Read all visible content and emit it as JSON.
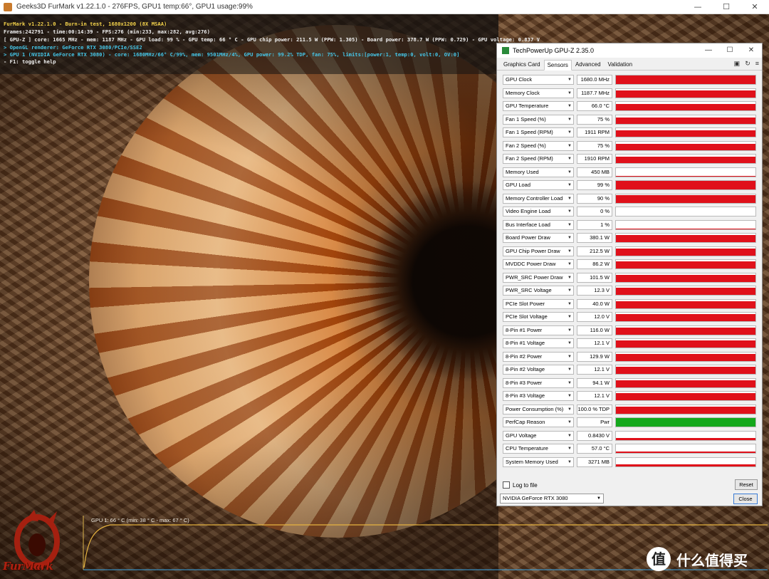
{
  "furmark": {
    "window_title": "Geeks3D FurMark v1.22.1.0 - 276FPS, GPU1 temp:66°, GPU1 usage:99%",
    "window_buttons": {
      "minimize": "—",
      "maximize": "☐",
      "close": "✕"
    },
    "overlay": [
      "FurMark v1.22.1.0 - Burn-in test, 1680x1200 (8X MSAA)",
      "Frames:242791 - time:00:14:39 - FPS:276 (min:233, max:282, avg:276)",
      "[ GPU-Z ] core: 1665 MHz - mem: 1187 MHz - GPU load: 99 % - GPU temp: 66 ° C - GPU chip power: 211.5 W (PPW: 1.305) - Board power: 378.7 W (PPW: 0.729) - GPU voltage: 0.837 V",
      "> OpenGL renderer: GeForce RTX 3080/PCIe/SSE2",
      "> GPU 1 (NVIDIA GeForce RTX 3080) - core: 1680MHz/66° C/99%, mem: 9501MHz/4%, GPU power: 99.2% TDP, fan: 75%, limits:[power:1, temp:0, volt:0, OV:0]",
      "- F1: toggle help"
    ],
    "graph_label": "GPU 1: 66 ° C (min: 38 ° C - max: 67 ° C)",
    "logo_text": "FurMark",
    "colors": {
      "overlay_yellow": "#f2d14a",
      "overlay_cyan": "#45c6e8",
      "graph_line": "#e6b340"
    }
  },
  "gpuz": {
    "title": "TechPowerUp GPU-Z 2.35.0",
    "window_buttons": {
      "minimize": "—",
      "maximize": "☐",
      "close": "✕"
    },
    "tabs": [
      "Graphics Card",
      "Sensors",
      "Advanced",
      "Validation"
    ],
    "active_tab": "Sensors",
    "tool_icons": {
      "camera": "▣",
      "refresh": "↻",
      "menu": "≡"
    },
    "sensors": [
      {
        "name": "GPU Clock",
        "value": "1680.0 MHz",
        "level": 1.0,
        "color": "#e0101a"
      },
      {
        "name": "Memory Clock",
        "value": "1187.7 MHz",
        "level": 0.85,
        "color": "#e0101a"
      },
      {
        "name": "GPU Temperature",
        "value": "66.0 °C",
        "level": 0.75,
        "color": "#e0101a"
      },
      {
        "name": "Fan 1 Speed (%)",
        "value": "75 %",
        "level": 0.75,
        "color": "#e0101a"
      },
      {
        "name": "Fan 1 Speed (RPM)",
        "value": "1911 RPM",
        "level": 0.75,
        "color": "#e0101a"
      },
      {
        "name": "Fan 2 Speed (%)",
        "value": "75 %",
        "level": 0.75,
        "color": "#e0101a"
      },
      {
        "name": "Fan 2 Speed (RPM)",
        "value": "1910 RPM",
        "level": 0.75,
        "color": "#e0101a"
      },
      {
        "name": "Memory Used",
        "value": "450 MB",
        "level": 0.08,
        "color": "#e0101a"
      },
      {
        "name": "GPU Load",
        "value": "99 %",
        "level": 0.99,
        "color": "#e0101a"
      },
      {
        "name": "Memory Controller Load",
        "value": "90 %",
        "level": 0.9,
        "color": "#e0101a"
      },
      {
        "name": "Video Engine Load",
        "value": "0 %",
        "level": 0.0,
        "color": "#e0101a"
      },
      {
        "name": "Bus Interface Load",
        "value": "1 %",
        "level": 0.05,
        "color": "#e0101a"
      },
      {
        "name": "Board Power Draw",
        "value": "380.1 W",
        "level": 0.85,
        "color": "#e0101a"
      },
      {
        "name": "GPU Chip Power Draw",
        "value": "212.5 W",
        "level": 0.85,
        "color": "#e0101a"
      },
      {
        "name": "MVDDC Power Draw",
        "value": "86.2 W",
        "level": 0.85,
        "color": "#e0101a"
      },
      {
        "name": "PWR_SRC Power Draw",
        "value": "101.5 W",
        "level": 0.85,
        "color": "#e0101a"
      },
      {
        "name": "PWR_SRC Voltage",
        "value": "12.3 V",
        "level": 0.85,
        "color": "#e0101a"
      },
      {
        "name": "PCIe Slot Power",
        "value": "40.0 W",
        "level": 0.8,
        "color": "#e0101a"
      },
      {
        "name": "PCIe Slot Voltage",
        "value": "12.0 V",
        "level": 0.85,
        "color": "#e0101a"
      },
      {
        "name": "8-Pin #1 Power",
        "value": "116.0 W",
        "level": 0.85,
        "color": "#e0101a"
      },
      {
        "name": "8-Pin #1 Voltage",
        "value": "12.1 V",
        "level": 0.85,
        "color": "#e0101a"
      },
      {
        "name": "8-Pin #2 Power",
        "value": "129.9 W",
        "level": 0.85,
        "color": "#e0101a"
      },
      {
        "name": "8-Pin #2 Voltage",
        "value": "12.1 V",
        "level": 0.85,
        "color": "#e0101a"
      },
      {
        "name": "8-Pin #3 Power",
        "value": "94.1 W",
        "level": 0.85,
        "color": "#e0101a"
      },
      {
        "name": "8-Pin #3 Voltage",
        "value": "12.1 V",
        "level": 0.85,
        "color": "#e0101a"
      },
      {
        "name": "Power Consumption (%)",
        "value": "100.0 % TDP",
        "level": 0.85,
        "color": "#e0101a"
      },
      {
        "name": "PerfCap Reason",
        "value": "Pwr",
        "level": 1.0,
        "color": "#14a81c"
      },
      {
        "name": "GPU Voltage",
        "value": "0.8430 V",
        "level": 0.2,
        "color": "#e0101a"
      },
      {
        "name": "CPU Temperature",
        "value": "57.0 °C",
        "level": 0.2,
        "color": "#e0101a"
      },
      {
        "name": "System Memory Used",
        "value": "3271 MB",
        "level": 0.2,
        "color": "#e0101a"
      }
    ],
    "log_to_file_label": "Log to file",
    "log_to_file_checked": false,
    "reset_label": "Reset",
    "device_select": "NVIDIA GeForce RTX 3080",
    "close_label": "Close"
  },
  "watermark": {
    "badge": "值",
    "text": "什么值得买"
  }
}
